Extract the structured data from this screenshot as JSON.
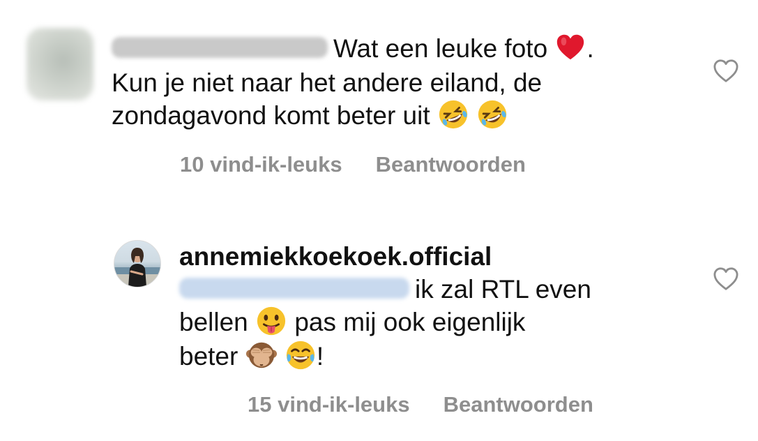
{
  "comments": [
    {
      "text_line_1": "Wat een leuke foto",
      "text_after_heart": ".",
      "text_line_2": "Kun je niet naar het andere eiland, de",
      "text_line_3": "zondagavond komt beter uit",
      "likes": "10 vind-ik-leuks",
      "reply": "Beantwoorden",
      "icons": [
        "heart-emoji",
        "rofl-emoji",
        "rofl-emoji",
        "heart-outline-icon"
      ]
    },
    {
      "username": "annemiekkoekoek.official",
      "text_part_1": "ik zal RTL even",
      "text_part_2": "bellen",
      "text_part_3": "pas mij ook eigenlijk",
      "text_part_4": "beter",
      "text_part_5": "!",
      "likes": "15 vind-ik-leuks",
      "reply": "Beantwoorden",
      "icons": [
        "tongue-emoji",
        "see-no-evil-monkey-emoji",
        "tears-of-joy-emoji",
        "heart-outline-icon"
      ]
    }
  ],
  "colors": {
    "text": "#111111",
    "meta": "#8e8e8e",
    "mention_blur": "#c8d9ee",
    "heart_emoji": "#e0182d",
    "emoji_yellow": "#f7c22b"
  }
}
